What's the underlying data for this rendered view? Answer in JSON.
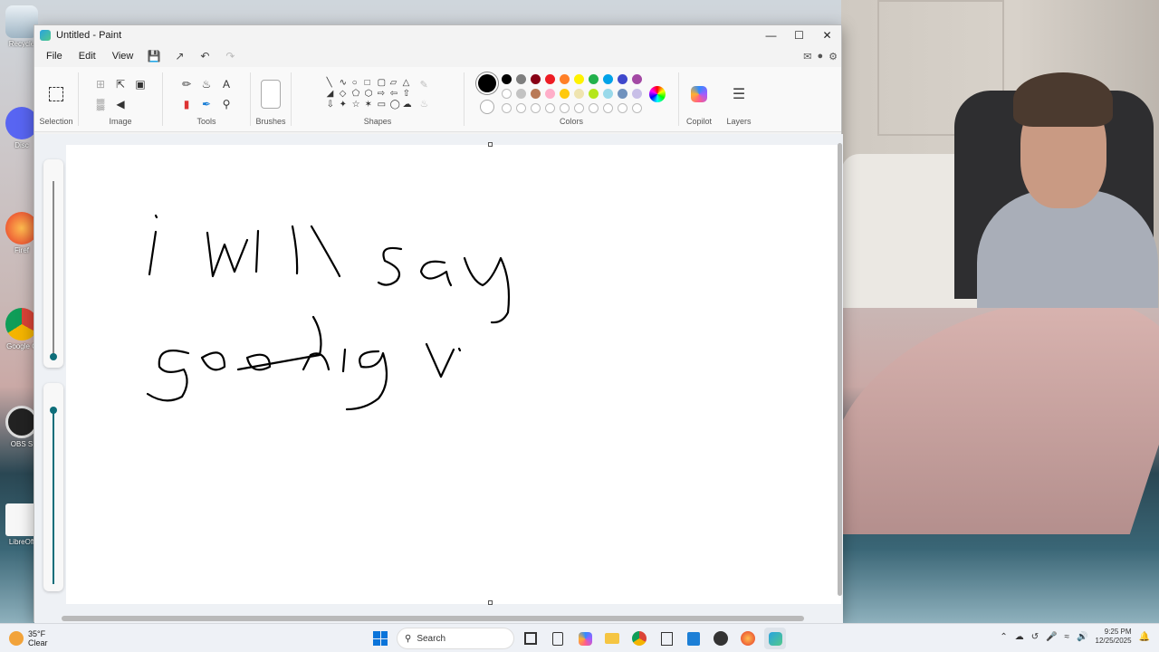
{
  "window": {
    "title": "Untitled - Paint"
  },
  "menu": {
    "file": "File",
    "edit": "Edit",
    "view": "View"
  },
  "ribbon": {
    "selection": "Selection",
    "image": "Image",
    "tools": "Tools",
    "brushes": "Brushes",
    "shapes": "Shapes",
    "colors": "Colors",
    "copilot": "Copilot",
    "layers": "Layers"
  },
  "colors": {
    "primary": "#000000",
    "row1": [
      "#000000",
      "#7f7f7f",
      "#880015",
      "#ed1c24",
      "#ff7f27",
      "#fff200",
      "#22b14c",
      "#00a2e8",
      "#3f48cc",
      "#a349a4"
    ],
    "row2": [
      "#ffffff",
      "#c3c3c3",
      "#b97a57",
      "#ffaec9",
      "#ffc90e",
      "#efe4b0",
      "#b5e61d",
      "#99d9ea",
      "#7092be",
      "#c8bfe7"
    ]
  },
  "canvas": {
    "line1": "i will say",
    "line2": "goodnigv"
  },
  "desktop": {
    "icons": [
      "Recycle",
      "Disc",
      "Firef",
      "Google C",
      "OBS S",
      "LibreOff"
    ]
  },
  "taskbar": {
    "temp": "35°F",
    "weather": "Clear",
    "search": "Search",
    "time": "9:25 PM",
    "date": "12/25/2025"
  }
}
